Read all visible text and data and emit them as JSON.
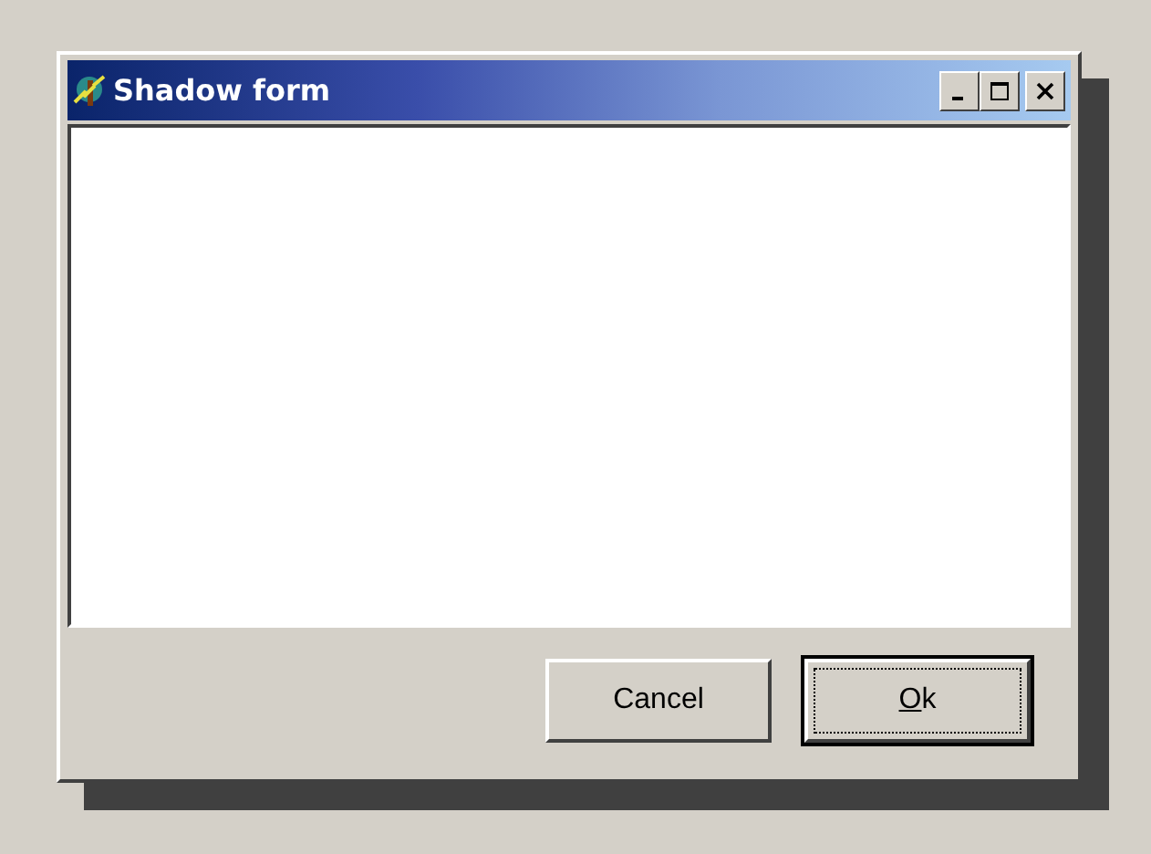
{
  "window": {
    "title": "Shadow form",
    "shadow": true
  },
  "title_controls": [
    {
      "kind": "minimize"
    },
    {
      "kind": "maximize"
    },
    {
      "kind": "close"
    }
  ],
  "buttons": [
    {
      "label": "Cancel",
      "default": false,
      "mnemonic": false
    },
    {
      "label": "Ok",
      "default": true,
      "mnemonic": true
    }
  ]
}
